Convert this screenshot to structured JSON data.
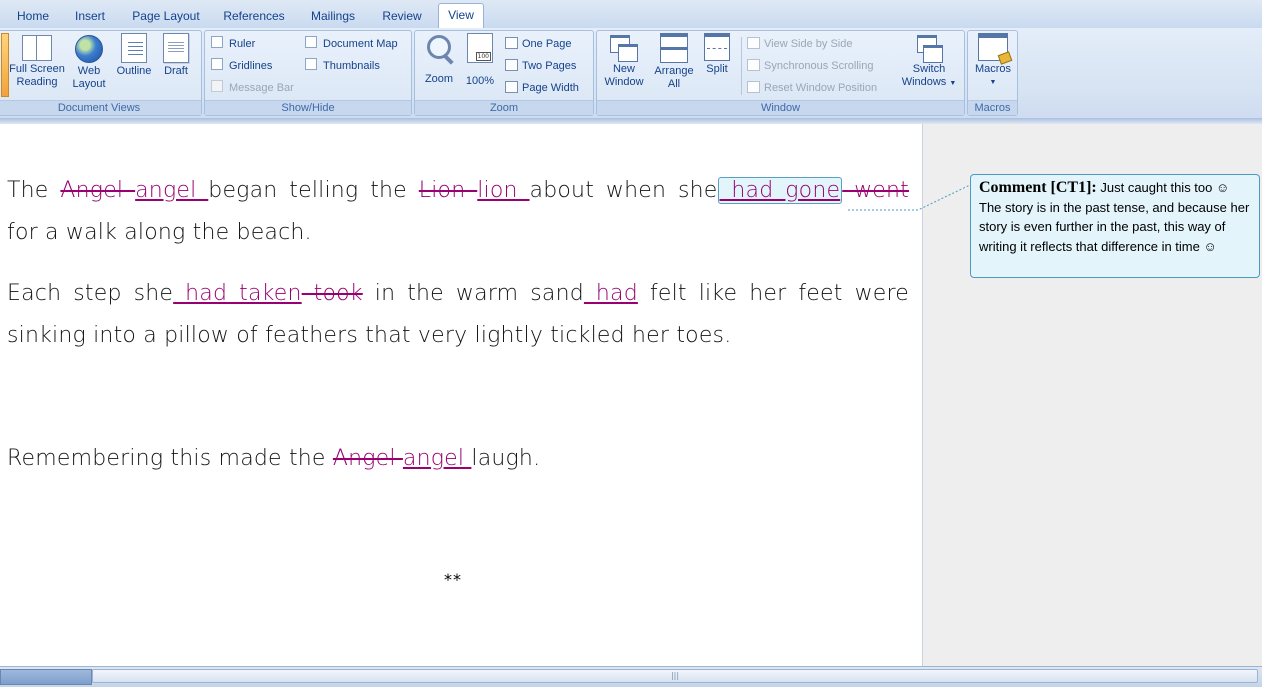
{
  "tabs": [
    {
      "label": "Home"
    },
    {
      "label": "Insert"
    },
    {
      "label": "Page Layout"
    },
    {
      "label": "References"
    },
    {
      "label": "Mailings"
    },
    {
      "label": "Review"
    },
    {
      "label": "View",
      "active": true
    }
  ],
  "ribbon": {
    "document_views": {
      "label": "Document Views",
      "full_screen": [
        "Full Screen",
        "Reading"
      ],
      "web_layout": [
        "Web",
        "Layout"
      ],
      "outline": "Outline",
      "draft": "Draft"
    },
    "show_hide": {
      "label": "Show/Hide",
      "ruler": "Ruler",
      "gridlines": "Gridlines",
      "message_bar": "Message Bar",
      "document_map": "Document Map",
      "thumbnails": "Thumbnails"
    },
    "zoom": {
      "label": "Zoom",
      "zoom": "Zoom",
      "hundred": "100%",
      "one_page": "One Page",
      "two_pages": "Two Pages",
      "page_width": "Page Width"
    },
    "window": {
      "label": "Window",
      "new_window": [
        "New",
        "Window"
      ],
      "arrange_all": [
        "Arrange",
        "All"
      ],
      "split": "Split",
      "view_side_by_side": "View Side by Side",
      "synchronous_scrolling": "Synchronous Scrolling",
      "reset_window_position": "Reset Window Position",
      "switch_windows": [
        "Switch",
        "Windows"
      ]
    },
    "macros": {
      "label": "Macros",
      "macros": "Macros"
    }
  },
  "document": {
    "p1": {
      "w1": "The ",
      "del1": "Angel ",
      "ins1": "angel ",
      "w2": "began telling the ",
      "del2": "Lion ",
      "ins2": "lion ",
      "w3": "about when she",
      "ins3": " had gone",
      "del3": " went",
      "line2": "for a walk along the beach."
    },
    "p2": {
      "w1": "Each step she",
      "ins1": " had taken",
      "del1": " took",
      "w2": " in the warm sand",
      "ins2": " had",
      "w3": " felt like her feet were",
      "line2": "sinking into a pillow of feathers that very lightly tickled her toes."
    },
    "p3": {
      "w1": "Remembering this made the ",
      "del1": "Angel ",
      "ins1": "angel ",
      "w2": "laugh."
    },
    "stars": "**"
  },
  "comment": {
    "title": "Comment [CT1]:",
    "text": " Just caught this too ☺ The story is in the past tense, and because her story is even further in the past, this way of writing it reflects that difference in time ☺"
  },
  "colors": {
    "revision": "#990070",
    "balloon_bg": "#e3f4fb",
    "balloon_border": "#4a9bc4",
    "ribbon_text": "#15428b"
  }
}
